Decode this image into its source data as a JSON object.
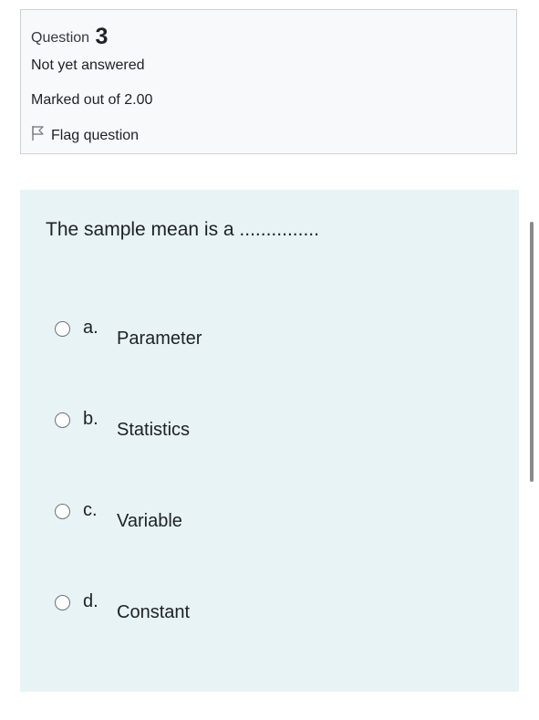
{
  "info": {
    "question_label": "Question",
    "question_number": "3",
    "state": "Not yet answered",
    "grade": "Marked out of 2.00",
    "flag_label": "Flag question"
  },
  "question": {
    "text": "The sample mean is a ...............",
    "answers": [
      {
        "letter": "a.",
        "label": "Parameter"
      },
      {
        "letter": "b.",
        "label": "Statistics"
      },
      {
        "letter": "c.",
        "label": "Variable"
      },
      {
        "letter": "d.",
        "label": "Constant"
      }
    ]
  },
  "icons": {
    "flag": "flag-icon",
    "radio": "radio-unchecked-icon"
  },
  "colors": {
    "info_background": "#f8f9fa",
    "content_background": "#e7f3f5",
    "border": "#cfd2d4",
    "text": "#1d2125"
  }
}
